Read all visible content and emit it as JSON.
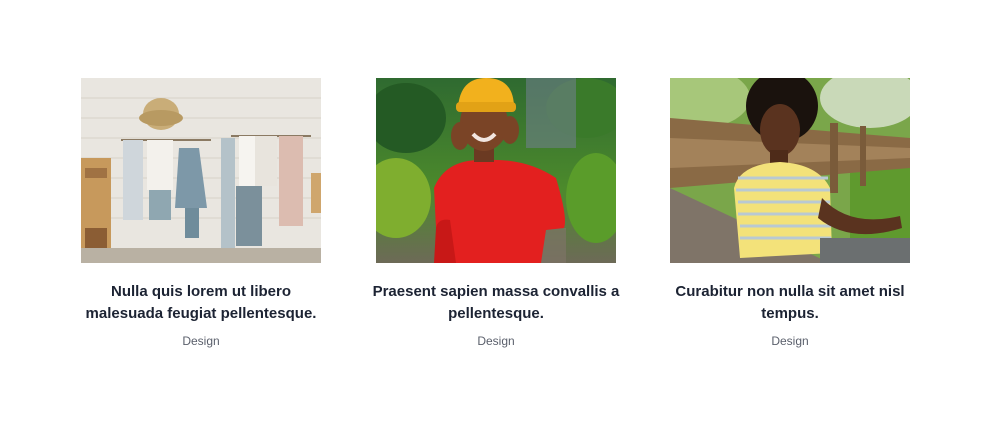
{
  "posts": [
    {
      "image_alt": "Clothing store interior with hanging scarves and hat",
      "title": "Nulla quis lorem ut libero malesuada feugiat pellentesque.",
      "category": "Design"
    },
    {
      "image_alt": "Smiling woman in yellow beanie and red sweater",
      "title": "Praesent sapien massa convallis a pellentesque.",
      "category": "Design"
    },
    {
      "image_alt": "Woman in yellow striped shirt leaning on guardrail",
      "title": "Curabitur non nulla sit amet nisl tempus.",
      "category": "Design"
    }
  ]
}
